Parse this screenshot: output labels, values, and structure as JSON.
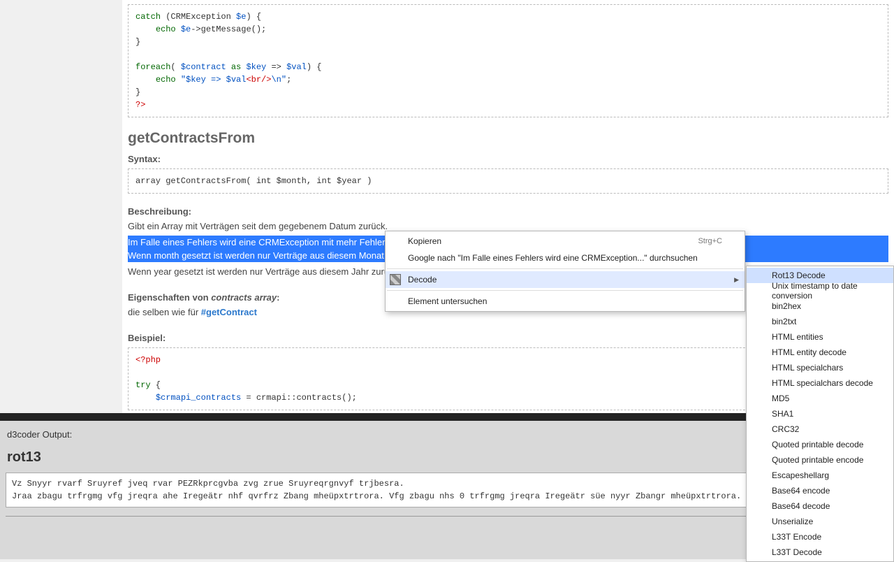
{
  "code_top": "catch (CRMException $e) {\n    echo $e->getMessage();\n}\n\nforeach( $contract as $key => $val) {\n    echo \"$key => $val<br/>\\n\";\n}\n?>",
  "method_heading": "getContractsFrom",
  "syntax_label": "Syntax:",
  "syntax_code": "array getContractsFrom( int $month, int $year )",
  "desc_label": "Beschreibung:",
  "desc1": "Gibt ein Array mit Verträgen seit dem gegebenem Datum zurück.",
  "desc_sel1": "Im Falle eines Fehlers wird eine CRMException mit mehr Fehlerdetails geworfen.",
  "desc_sel2": "Wenn month gesetzt ist werden nur Verträge aus diesem Monat :",
  "desc3": "Wenn year gesetzt ist werden nur Verträge aus diesem Jahr zurü",
  "props_label_prefix": "Eigenschaften von ",
  "props_label_em": "contracts array",
  "props_text": "die selben wie für ",
  "props_link": "#getContract",
  "example_label": "Beispiel:",
  "code_example": "<?php\n\ntry {\n    $crmapi_contracts = crmapi::contracts();",
  "context_menu": {
    "copy": "Kopieren",
    "copy_shortcut": "Strg+C",
    "google": "Google nach \"Im Falle eines Fehlers wird eine CRMException...\" durchsuchen",
    "decode": "Decode",
    "inspect": "Element untersuchen"
  },
  "submenu_items": [
    "Rot13 Decode",
    "Unix timestamp to date conversion",
    "bin2hex",
    "bin2txt",
    "HTML entities",
    "HTML entity decode",
    "HTML specialchars",
    "HTML specialchars decode",
    "MD5",
    "SHA1",
    "CRC32",
    "Quoted printable decode",
    "Quoted printable encode",
    "Escapeshellarg",
    "Base64 encode",
    "Base64 decode",
    "Unserialize",
    "L33T Encode",
    "L33T Decode"
  ],
  "output": {
    "panel_title": "d3coder Output:",
    "section": "rot13",
    "text": "Vz Snyyr rvarf Sruyref jveq rvar PEZRkprcgvba zvg zrue Sruyreqrgnvyf trjbesra.\nJraa zbagu trfrgmg vfg jreqra ahe Iregeätr nhf qvrfrz Zbang mheüpxtrtrora. Vfg zbagu nhs 0 trfrgmg jreqra Iregeätr süe nyyr Zbangr mheüpxtrtrora."
  }
}
